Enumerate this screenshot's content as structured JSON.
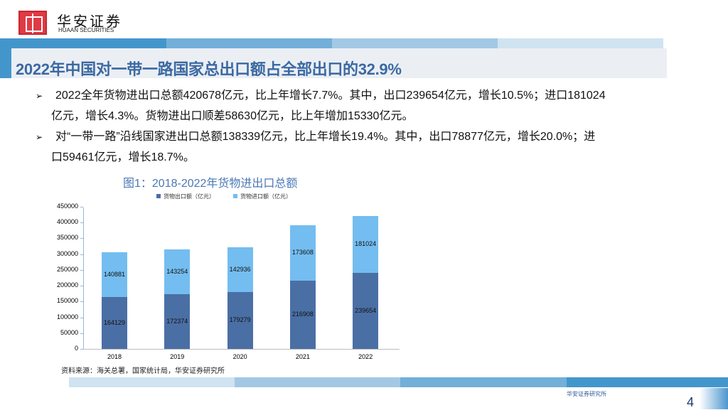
{
  "brand": {
    "name_cn": "华安证券",
    "name_en": "HUAAN SECURITIES",
    "footer": "华安证券研究所"
  },
  "title": "2022年中国对一带一路国家总出口额占全部出口的32.9%",
  "bullets": [
    "2022全年货物进出口总额420678亿元，比上年增长7.7%。其中，出口239654亿元，增长10.5%；进口181024亿元，增长4.3%。货物进出口顺差58630亿元，比上年增加15330亿元。",
    "对“一带一路”沿线国家进出口总额138339亿元，比上年增长19.4%。其中，出口78877亿元，增长20.0%；进口59461亿元，增长18.7%。"
  ],
  "bullet_icon": "arrow-bullet-icon",
  "page_number": "4",
  "source": "资料来源：海关总署，国家统计局，华安证券研究所",
  "chart_data": {
    "type": "bar",
    "stacked": true,
    "title": "图1：2018-2022年货物进出口总额",
    "categories": [
      "2018",
      "2019",
      "2020",
      "2021",
      "2022"
    ],
    "series": [
      {
        "name": "货物出口额（亿元）",
        "color": "#4a6fa5",
        "values": [
          164129,
          172374,
          179279,
          216908,
          239654
        ]
      },
      {
        "name": "货物进口额（亿元）",
        "color": "#74bdf0",
        "values": [
          140881,
          143254,
          142936,
          173608,
          181024
        ]
      }
    ],
    "ylim": [
      0,
      450000
    ],
    "yticks": [
      "0",
      "50000",
      "100000",
      "150000",
      "200000",
      "250000",
      "300000",
      "350000",
      "400000",
      "450000"
    ],
    "legend": "top",
    "grid": false
  }
}
